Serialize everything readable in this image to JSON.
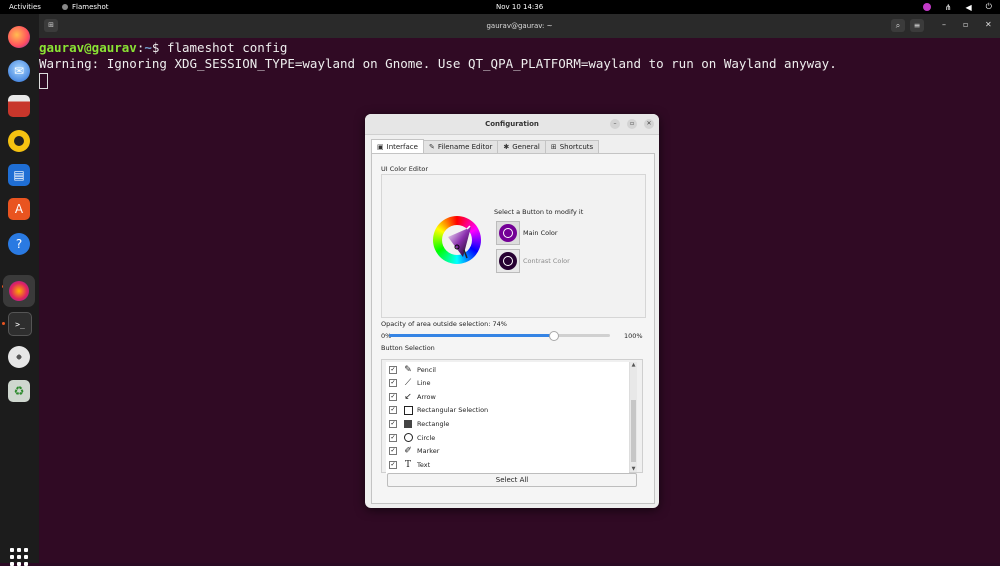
{
  "topbar": {
    "activities": "Activities",
    "app_name": "Flameshot",
    "clock": "Nov 10  14:36"
  },
  "dock": {
    "items": [
      "firefox-icon",
      "thunderbird-icon",
      "files-icon",
      "rhythmbox-icon",
      "libreoffice-writer-icon",
      "app-center-icon",
      "help-icon",
      "flameshot-icon",
      "terminal-icon",
      "disc-icon",
      "trash-icon"
    ]
  },
  "terminal": {
    "title": "gaurav@gaurav: ~",
    "line1_user": "gaurav@gaurav",
    "line1_sep": ":",
    "line1_path": "~",
    "line1_cmd": "$ flameshot config",
    "line2": "Warning: Ignoring XDG_SESSION_TYPE=wayland on Gnome. Use QT_QPA_PLATFORM=wayland to run on Wayland anyway."
  },
  "dialog": {
    "title": "Configuration",
    "tabs": [
      {
        "label": "Interface",
        "icon": "monitor-icon"
      },
      {
        "label": "Filename Editor",
        "icon": "pen-icon"
      },
      {
        "label": "General",
        "icon": "wrench-icon"
      },
      {
        "label": "Shortcuts",
        "icon": "grid-icon"
      }
    ],
    "color_editor_label": "UI Color Editor",
    "select_hint": "Select a Button to modify it",
    "main_color_label": "Main Color",
    "contrast_color_label": "Contrast Color",
    "main_color": "#740096",
    "contrast_color": "#270032",
    "opacity_label": "Opacity of area outside selection: 74%",
    "opacity_value": 74,
    "opacity_min": "0%",
    "opacity_max": "100%",
    "button_selection_label": "Button Selection",
    "buttons": [
      {
        "label": "Pencil",
        "icon": "pencil-icon",
        "checked": true
      },
      {
        "label": "Line",
        "icon": "line-icon",
        "checked": true
      },
      {
        "label": "Arrow",
        "icon": "arrow-icon",
        "checked": true
      },
      {
        "label": "Rectangular Selection",
        "icon": "rectangle-outline-icon",
        "checked": true
      },
      {
        "label": "Rectangle",
        "icon": "rectangle-filled-icon",
        "checked": true
      },
      {
        "label": "Circle",
        "icon": "circle-icon",
        "checked": true
      },
      {
        "label": "Marker",
        "icon": "marker-icon",
        "checked": true
      },
      {
        "label": "Text",
        "icon": "text-icon",
        "checked": true
      }
    ],
    "select_all": "Select All"
  }
}
